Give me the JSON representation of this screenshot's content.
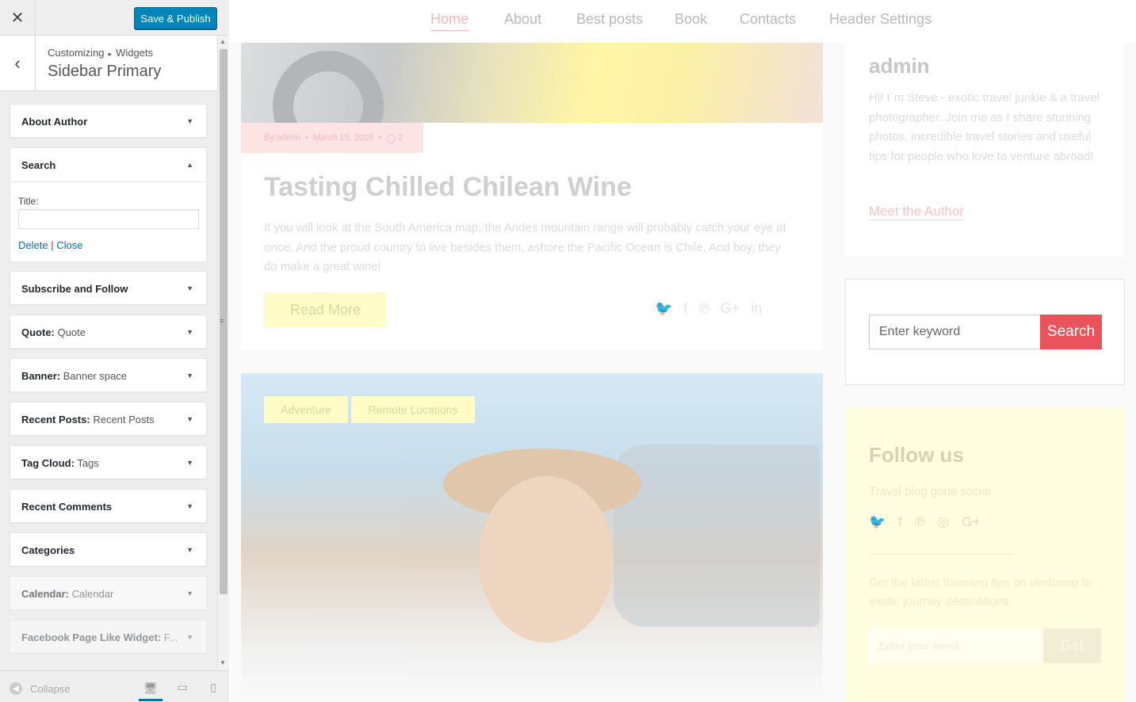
{
  "customizer": {
    "close_icon": "close-icon",
    "publish_label": "Save & Publish",
    "breadcrumb": {
      "parent": "Customizing",
      "child": "Widgets"
    },
    "panel_title": "Sidebar Primary",
    "widgets": {
      "about_author": {
        "title": "About Author",
        "sub": ""
      },
      "search": {
        "title": "Search",
        "field_label": "Title:",
        "field_value": "",
        "delete_label": "Delete",
        "separator": "|",
        "close_label": "Close"
      },
      "subscribe": {
        "title": "Subscribe and Follow",
        "sub": ""
      },
      "quote": {
        "title": "Quote:",
        "sub": "Quote"
      },
      "banner": {
        "title": "Banner:",
        "sub": "Banner space"
      },
      "recent_posts": {
        "title": "Recent Posts:",
        "sub": "Recent Posts"
      },
      "tag_cloud": {
        "title": "Tag Cloud:",
        "sub": "Tags"
      },
      "recent_comments": {
        "title": "Recent Comments",
        "sub": ""
      },
      "categories": {
        "title": "Categories",
        "sub": ""
      },
      "calendar": {
        "title": "Calendar:",
        "sub": "Calendar"
      },
      "facebook": {
        "title": "Facebook Page Like Widget:",
        "sub": "F..."
      }
    },
    "footer": {
      "collapse_label": "Collapse"
    }
  },
  "preview": {
    "nav": [
      "Home",
      "About",
      "Best posts",
      "Book",
      "Contacts",
      "Header Settings"
    ],
    "post1": {
      "meta_author": "By admin",
      "meta_date": "March 15, 2016",
      "meta_comments": "2",
      "title": "Tasting Chilled Chilean Wine",
      "excerpt": "If you will look at the South America map, the Andes mountain range will probably catch your eye at once. And the proud country to live besides them, ashore the Pacific Ocean is Chile. And boy, they do make a great wine!",
      "read_more": "Read More"
    },
    "post2": {
      "tags": [
        "Adventure",
        "Remote Locations"
      ]
    },
    "author_widget": {
      "name": "admin",
      "bio": "Hi! I`m Steve - exotic travel junkie & a travel photographer. Join me as I share stunning photos, incredible travel stories and useful tips for people who love to venture abroad!",
      "link": "Meet the Author"
    },
    "search_widget": {
      "placeholder": "Enter keyword",
      "button": "Search"
    },
    "follow_widget": {
      "title": "Follow us",
      "subtitle": "Travel blog gone social",
      "newsletter": "Get the latest traveling tips on venturing to exotic journey destinations.",
      "email_placeholder": "Enter your email",
      "button": "Get"
    }
  },
  "colors": {
    "accent": "#0085ba",
    "search_button": "#e9535b",
    "nav_active": "#f4b8b8"
  }
}
